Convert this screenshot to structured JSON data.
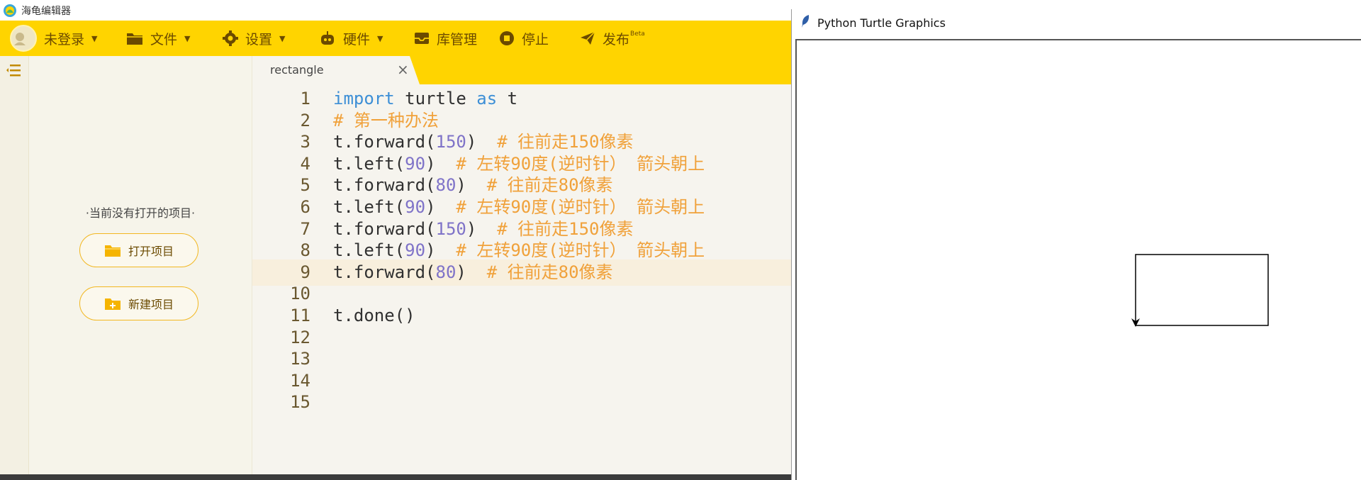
{
  "app": {
    "title": "海龟编辑器"
  },
  "toolbar": {
    "login_label": "未登录",
    "file_label": "文件",
    "settings_label": "设置",
    "hardware_label": "硬件",
    "library_label": "库管理",
    "stop_label": "停止",
    "publish_label": "发布",
    "publish_badge": "Beta"
  },
  "project_panel": {
    "no_project_text": "·当前没有打开的项目·",
    "open_project_label": "打开项目",
    "new_project_label": "新建项目"
  },
  "editor": {
    "tab_name": "rectangle",
    "active_line": 9,
    "lines": [
      {
        "n": "1",
        "segments": [
          {
            "t": "import",
            "c": "kw"
          },
          {
            "t": " turtle ",
            "c": "plain"
          },
          {
            "t": "as",
            "c": "kw"
          },
          {
            "t": " t",
            "c": "plain"
          }
        ]
      },
      {
        "n": "2",
        "segments": [
          {
            "t": "# 第一种办法",
            "c": "cmt"
          }
        ]
      },
      {
        "n": "3",
        "segments": [
          {
            "t": "t.forward(",
            "c": "plain"
          },
          {
            "t": "150",
            "c": "num"
          },
          {
            "t": ")  ",
            "c": "plain"
          },
          {
            "t": "# 往前走150像素",
            "c": "cmt"
          }
        ]
      },
      {
        "n": "4",
        "segments": [
          {
            "t": "t.left(",
            "c": "plain"
          },
          {
            "t": "90",
            "c": "num"
          },
          {
            "t": ")  ",
            "c": "plain"
          },
          {
            "t": "# 左转90度(逆时针） 箭头朝上",
            "c": "cmt"
          }
        ]
      },
      {
        "n": "5",
        "segments": [
          {
            "t": "t.forward(",
            "c": "plain"
          },
          {
            "t": "80",
            "c": "num"
          },
          {
            "t": ")  ",
            "c": "plain"
          },
          {
            "t": "# 往前走80像素",
            "c": "cmt"
          }
        ]
      },
      {
        "n": "6",
        "segments": [
          {
            "t": "t.left(",
            "c": "plain"
          },
          {
            "t": "90",
            "c": "num"
          },
          {
            "t": ")  ",
            "c": "plain"
          },
          {
            "t": "# 左转90度(逆时针） 箭头朝上",
            "c": "cmt"
          }
        ]
      },
      {
        "n": "7",
        "segments": [
          {
            "t": "t.forward(",
            "c": "plain"
          },
          {
            "t": "150",
            "c": "num"
          },
          {
            "t": ")  ",
            "c": "plain"
          },
          {
            "t": "# 往前走150像素",
            "c": "cmt"
          }
        ]
      },
      {
        "n": "8",
        "segments": [
          {
            "t": "t.left(",
            "c": "plain"
          },
          {
            "t": "90",
            "c": "num"
          },
          {
            "t": ")  ",
            "c": "plain"
          },
          {
            "t": "# 左转90度(逆时针） 箭头朝上",
            "c": "cmt"
          }
        ]
      },
      {
        "n": "9",
        "segments": [
          {
            "t": "t.forward(",
            "c": "plain"
          },
          {
            "t": "80",
            "c": "num"
          },
          {
            "t": ")  ",
            "c": "plain"
          },
          {
            "t": "# 往前走80像素",
            "c": "cmt"
          }
        ]
      },
      {
        "n": "10",
        "segments": []
      },
      {
        "n": "11",
        "segments": [
          {
            "t": "t.done()",
            "c": "plain"
          }
        ]
      },
      {
        "n": "12",
        "segments": []
      },
      {
        "n": "13",
        "segments": []
      },
      {
        "n": "14",
        "segments": []
      },
      {
        "n": "15",
        "segments": []
      }
    ]
  },
  "turtle_window": {
    "title": "Python Turtle Graphics"
  },
  "colors": {
    "toolbar": "#ffd400",
    "keyword": "#3d8fd6",
    "number": "#7f73c8",
    "comment": "#f0a13a"
  },
  "icons": [
    "app-logo-icon",
    "user-avatar-icon",
    "folder-icon",
    "gear-icon",
    "robot-icon",
    "inbox-icon",
    "stop-icon",
    "paper-plane-icon",
    "menu-icon",
    "close-icon",
    "feather-icon"
  ]
}
